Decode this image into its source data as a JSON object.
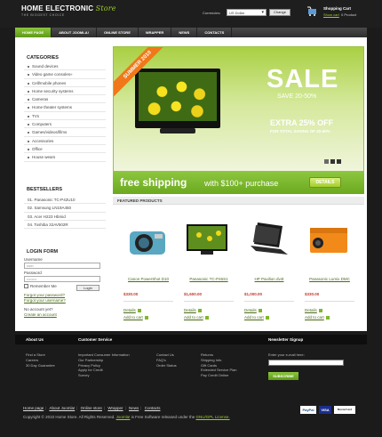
{
  "header": {
    "logo_main": "HOME ELECTRONIC",
    "logo_script": "Store",
    "logo_sub": "THE BIGGEST CHOICE",
    "currencies_label": "Currencies:",
    "currency_value": "US Dollar",
    "change_label": "Change",
    "cart_title": "Shopping Cart",
    "cart_show": "Show cart",
    "cart_count": "0 Product"
  },
  "nav": [
    "Home page",
    "About Joomla!",
    "Online store",
    "Wrapper",
    "News",
    "Contacts"
  ],
  "categories": {
    "title": "CATEGORIES",
    "items": [
      "Sound devices",
      "Video game consoles»",
      "Cell/mobile phones",
      "Home security systems",
      "Cameras",
      "Home theater systems",
      "TVs",
      "Computers",
      "Games/videos/films",
      "Accessories",
      "Office",
      "House wears"
    ]
  },
  "bestsellers": {
    "title": "BESTSELLERS",
    "items": [
      "01. Panasonic TC-P42U10",
      "02. Samsung LN19A450",
      "03. Acer H223 Hbmid",
      "04. Toshiba 32AV502R"
    ]
  },
  "login": {
    "title": "LOGIN FORM",
    "username_label": "Username",
    "username_value": "user",
    "password_label": "Password",
    "password_value": "••••••••",
    "remember_label": "Remember Me",
    "login_btn": "Login",
    "forgot_password": "Forgot your password?",
    "forgot_username": "Forgot your username?",
    "no_account": "No account yet?",
    "create_account": "Create an account"
  },
  "banner": {
    "ribbon": "SUMMER 2010",
    "sale": "SALE",
    "save": "SAVE 20-50%",
    "extra": "EXTRA 25% OFF",
    "extra_sub": "FOR TOTAL SAVING OF 40-60%",
    "ship_main": "free shipping",
    "ship_rest": "with $100+ purchase",
    "details": "DETAILS"
  },
  "featured": {
    "title": "FEATURED PRODUCTS",
    "products": [
      {
        "name": "Canon PowerShot D10",
        "price": "$330.00",
        "details": "Details",
        "cart": "Add to cart"
      },
      {
        "name": "Panasonic TC-P46S1",
        "price": "$1,600.00",
        "details": "Details",
        "cart": "Add to cart"
      },
      {
        "name": "HP Pavilion dv4t",
        "price": "$1,000.00",
        "details": "Details",
        "cart": "Add to cart"
      },
      {
        "name": "Panasonic Lumix DMC",
        "price": "$330.00",
        "details": "Details",
        "cart": "Add to cart"
      }
    ]
  },
  "footer": {
    "about_title": "About Us",
    "service_title": "Customer Service",
    "newsletter_title": "Newsletter Signup",
    "col1": [
      "Find a Store",
      "Careers",
      "30 Day Guarantee"
    ],
    "col2": [
      "Important Consumer Information",
      "Our Partnership",
      "Privacy Policy",
      "Apply for Credit",
      "Survey"
    ],
    "col3": [
      "Contact Us",
      "FAQ's",
      "Order Status"
    ],
    "col4": [
      "Returns",
      "Shipping Info",
      "Gift Cards",
      "Extended Service Plan",
      "Pay Credit Online"
    ],
    "newsletter_label": "Enter your e-mail here:",
    "subscribe": "SUBSCRIBE",
    "bottom_nav": [
      "Home page",
      "About Joomla!",
      "Online store",
      "Wrapper",
      "News",
      "Contacts"
    ],
    "copyright_pre": "Copyright © 2010 Home Store. All Rights Reserved.",
    "joomla": "Joomla!",
    "copyright_mid": "is Free Software released under the",
    "license": "GNU/GPL License.",
    "payments": [
      "PayPal",
      "VISA",
      "MasterCard"
    ]
  }
}
